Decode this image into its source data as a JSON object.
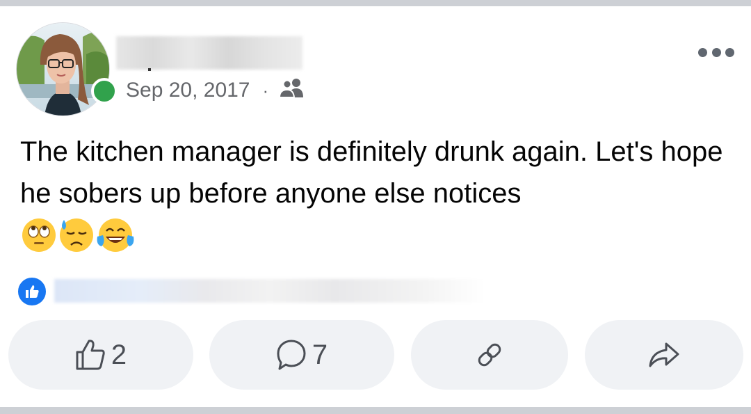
{
  "post": {
    "date": "Sep 20, 2017",
    "separator": "·",
    "audience_icon": "friends-icon",
    "text": "The kitchen manager is definitely drunk again. Let's hope he sobers up before anyone else notices",
    "emojis": [
      "face-with-rolling-eyes",
      "downcast-face-with-sweat",
      "face-with-tears-of-joy"
    ]
  },
  "actions": {
    "like_count": "2",
    "comment_count": "7"
  },
  "colors": {
    "online": "#31a24c",
    "like_blue": "#1877f2",
    "button_bg": "#f0f2f5",
    "meta_gray": "#65676b"
  }
}
